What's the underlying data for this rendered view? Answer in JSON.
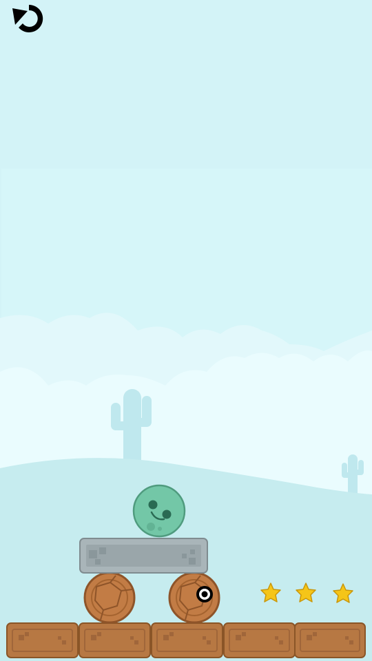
{
  "game": {
    "title": "",
    "restart_button": {
      "icon": "restart-icon"
    },
    "stars": {
      "count": 3,
      "color": "#f5c518"
    },
    "hero": {
      "type": "ball",
      "expression": "smile",
      "color": "#73c7a7"
    },
    "blocks": [
      {
        "kind": "stone-slab"
      },
      {
        "kind": "wooden-wheel"
      },
      {
        "kind": "wooden-wheel",
        "has_target_marker": true
      }
    ],
    "ground": {
      "tiles": 5,
      "material": "dirt"
    },
    "background": {
      "theme": "desert",
      "sky_color": "#d3f3f7"
    }
  }
}
